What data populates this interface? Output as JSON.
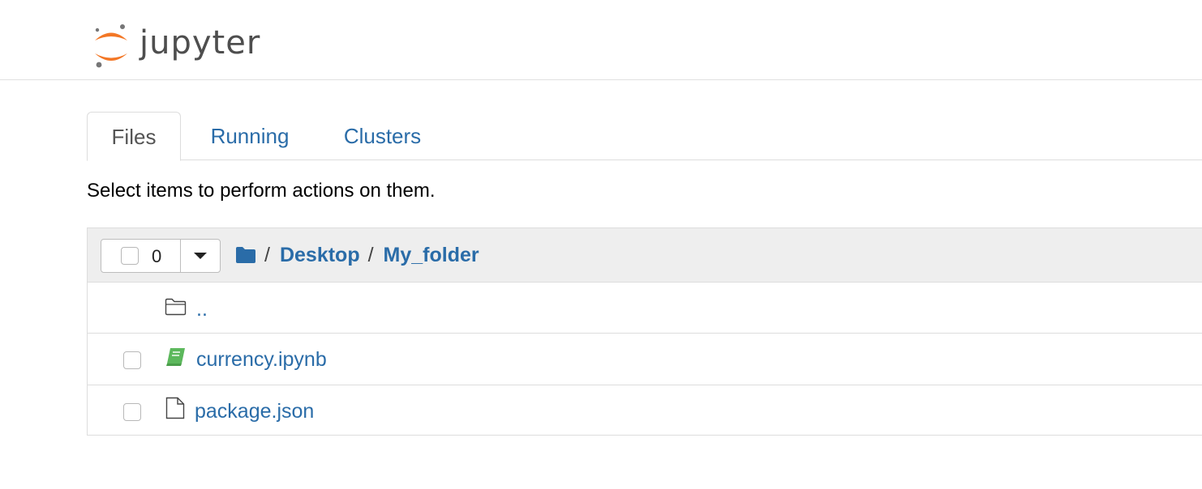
{
  "header": {
    "logo_text": "jupyter",
    "accent_color": "#F37726",
    "dot_color": "#767677"
  },
  "tabs": [
    {
      "label": "Files",
      "active": true
    },
    {
      "label": "Running",
      "active": false
    },
    {
      "label": "Clusters",
      "active": false
    }
  ],
  "help_text": "Select items to perform actions on them.",
  "toolbar": {
    "selected_count": "0",
    "breadcrumb": [
      {
        "label": "Desktop"
      },
      {
        "label": "My_folder"
      }
    ],
    "separator": "/",
    "folder_icon": "folder-solid-icon"
  },
  "files": [
    {
      "name": "..",
      "icon": "folder-outline-icon",
      "checkbox": false
    },
    {
      "name": "currency.ipynb",
      "icon": "notebook-icon",
      "checkbox": true,
      "icon_color": "#5cb85c"
    },
    {
      "name": "package.json",
      "icon": "file-icon",
      "checkbox": true
    }
  ],
  "colors": {
    "link": "#2a6ca8",
    "header_bg": "#eeeeee",
    "border": "#dddddd"
  }
}
